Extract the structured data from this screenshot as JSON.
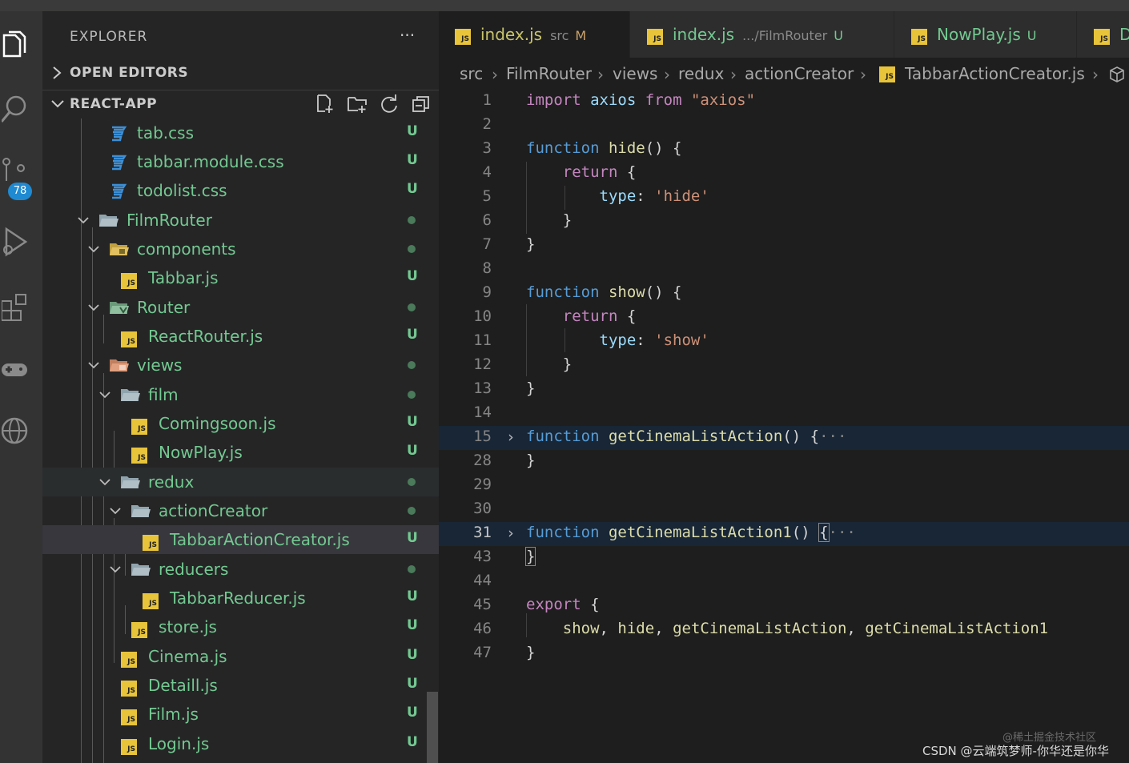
{
  "activity_bar": {
    "scm_badge": "78",
    "icons": [
      "explorer-icon",
      "search-icon",
      "source-control-icon",
      "run-debug-icon",
      "extensions-icon",
      "gamepad-icon",
      "globe-icon"
    ]
  },
  "sidebar": {
    "title": "EXPLORER",
    "more": "···",
    "open_editors": "OPEN EDITORS",
    "project": "REACT-APP"
  },
  "tree": [
    {
      "name": "tab.css",
      "type": "css",
      "status": "U"
    },
    {
      "name": "tabbar.module.css",
      "type": "css",
      "status": "U"
    },
    {
      "name": "todolist.css",
      "type": "css",
      "status": "U"
    },
    {
      "name": "FilmRouter",
      "type": "folder",
      "status": "dot"
    },
    {
      "name": "components",
      "type": "folder",
      "status": "dot"
    },
    {
      "name": "Tabbar.js",
      "type": "js",
      "status": "U"
    },
    {
      "name": "Router",
      "type": "folder",
      "status": "dot"
    },
    {
      "name": "ReactRouter.js",
      "type": "js",
      "status": "U"
    },
    {
      "name": "views",
      "type": "folder",
      "status": "dot"
    },
    {
      "name": "film",
      "type": "folder",
      "status": "dot"
    },
    {
      "name": "Comingsoon.js",
      "type": "js",
      "status": "U"
    },
    {
      "name": "NowPlay.js",
      "type": "js",
      "status": "U"
    },
    {
      "name": "redux",
      "type": "folder",
      "status": "dot"
    },
    {
      "name": "actionCreator",
      "type": "folder",
      "status": "dot"
    },
    {
      "name": "TabbarActionCreator.js",
      "type": "js",
      "status": "U"
    },
    {
      "name": "reducers",
      "type": "folder",
      "status": "dot"
    },
    {
      "name": "TabbarReducer.js",
      "type": "js",
      "status": "U"
    },
    {
      "name": "store.js",
      "type": "js",
      "status": "U"
    },
    {
      "name": "Cinema.js",
      "type": "js",
      "status": "U"
    },
    {
      "name": "Detaill.js",
      "type": "js",
      "status": "U"
    },
    {
      "name": "Film.js",
      "type": "js",
      "status": "U"
    },
    {
      "name": "Login.js",
      "type": "js",
      "status": "U"
    }
  ],
  "tabs": [
    {
      "name": "index.js",
      "path": "src",
      "status": "M"
    },
    {
      "name": "index.js",
      "path": ".../FilmRouter",
      "status": "U"
    },
    {
      "name": "NowPlay.js",
      "path": "",
      "status": "U"
    },
    {
      "name": "D",
      "path": "",
      "status": ""
    }
  ],
  "breadcrumb": [
    "src",
    "FilmRouter",
    "views",
    "redux",
    "actionCreator",
    "TabbarActionCreator.js"
  ],
  "editor": {
    "lines": [
      {
        "n": "1",
        "text": "import axios from \"axios\""
      },
      {
        "n": "2",
        "text": ""
      },
      {
        "n": "3",
        "text": "function hide() {"
      },
      {
        "n": "4",
        "text": "    return {"
      },
      {
        "n": "5",
        "text": "        type: 'hide'"
      },
      {
        "n": "6",
        "text": "    }"
      },
      {
        "n": "7",
        "text": "}"
      },
      {
        "n": "8",
        "text": ""
      },
      {
        "n": "9",
        "text": "function show() {"
      },
      {
        "n": "10",
        "text": "    return {"
      },
      {
        "n": "11",
        "text": "        type: 'show'"
      },
      {
        "n": "12",
        "text": "    }"
      },
      {
        "n": "13",
        "text": "}"
      },
      {
        "n": "14",
        "text": ""
      },
      {
        "n": "15",
        "text": "function getCinemaListAction() {···"
      },
      {
        "n": "28",
        "text": "}"
      },
      {
        "n": "29",
        "text": ""
      },
      {
        "n": "30",
        "text": ""
      },
      {
        "n": "31",
        "text": "function getCinemaListAction1() {···"
      },
      {
        "n": "43",
        "text": "}"
      },
      {
        "n": "44",
        "text": ""
      },
      {
        "n": "45",
        "text": "export {"
      },
      {
        "n": "46",
        "text": "    show, hide, getCinemaListAction, getCinemaListAction1"
      },
      {
        "n": "47",
        "text": "}"
      }
    ]
  },
  "watermark": {
    "line1": "@稀土掘金技术社区",
    "line2": "CSDN @云端筑梦师-你华还是你华"
  },
  "colors": {
    "accent_badge": "#1f8ad2",
    "untracked": "#73c991",
    "modified": "#c9a26b",
    "js_icon": "#e8c43a"
  }
}
